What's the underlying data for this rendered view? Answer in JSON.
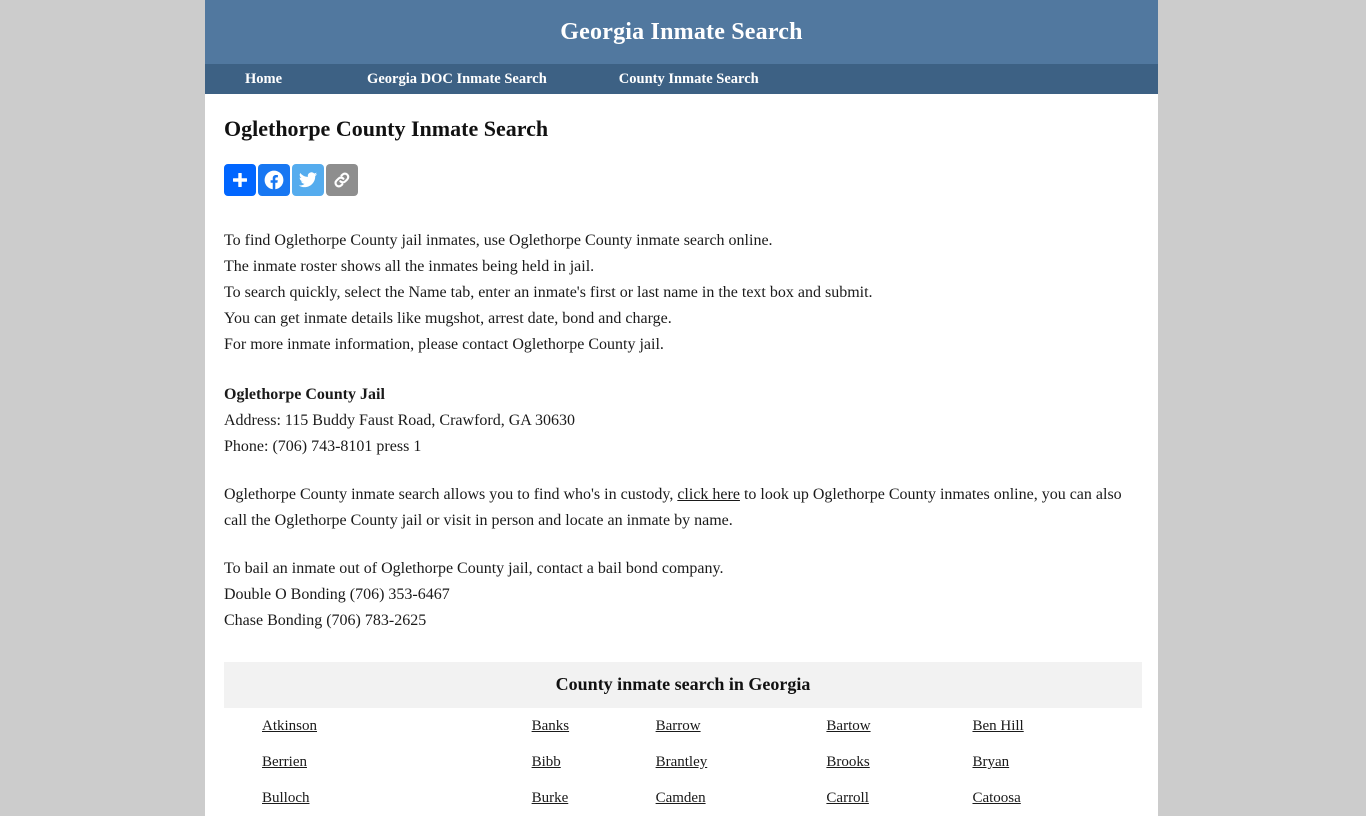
{
  "site": {
    "title": "Georgia Inmate Search",
    "header_bg": "#51789f",
    "nav_bg": "#3d6184",
    "page_bg": "#cccccc"
  },
  "nav": {
    "items": [
      {
        "label": "Home"
      },
      {
        "label": "Georgia DOC Inmate Search"
      },
      {
        "label": "County Inmate Search"
      }
    ]
  },
  "main": {
    "page_title": "Oglethorpe County Inmate Search",
    "share": {
      "buttons": [
        {
          "name": "share-icon",
          "label": "Share",
          "color": "#0166ff"
        },
        {
          "name": "facebook-icon",
          "label": "Facebook",
          "color": "#1877f2"
        },
        {
          "name": "twitter-icon",
          "label": "Twitter",
          "color": "#55acee"
        },
        {
          "name": "copy-link-icon",
          "label": "Copy Link",
          "color": "#8e8e8e"
        }
      ]
    },
    "intro_lines": [
      "To find Oglethorpe County jail inmates, use Oglethorpe County inmate search online.",
      "The inmate roster shows all the inmates being held in jail.",
      "To search quickly, select the Name tab, enter an inmate's first or last name in the text box and submit.",
      "You can get inmate details like mugshot, arrest date, bond and charge.",
      "For more inmate information, please contact Oglethorpe County jail."
    ],
    "jail": {
      "name": "Oglethorpe County Jail",
      "address": "Address: 115 Buddy Faust Road, Crawford, GA 30630",
      "phone": "Phone: (706) 743-8101 press 1"
    },
    "custody": {
      "text_before": "Oglethorpe County inmate search allows you to find who's in custody, ",
      "link_label": "click here",
      "text_after": " to look up Oglethorpe County inmates online, you can also call the Oglethorpe County jail or visit in person and locate an inmate by name."
    },
    "bail": {
      "intro": "To bail an inmate out of Oglethorpe County jail, contact a bail bond company.",
      "companies": [
        "Double O Bonding (706) 353-6467",
        "Chase Bonding (706) 783-2625"
      ]
    },
    "county_table": {
      "caption": "County inmate search in Georgia",
      "rows": [
        [
          "Atkinson",
          "Banks",
          "Barrow",
          "Bartow",
          "Ben Hill"
        ],
        [
          "Berrien",
          "Bibb",
          "Brantley",
          "Brooks",
          "Bryan"
        ],
        [
          "Bulloch",
          "Burke",
          "Camden",
          "Carroll",
          "Catoosa"
        ]
      ]
    }
  }
}
